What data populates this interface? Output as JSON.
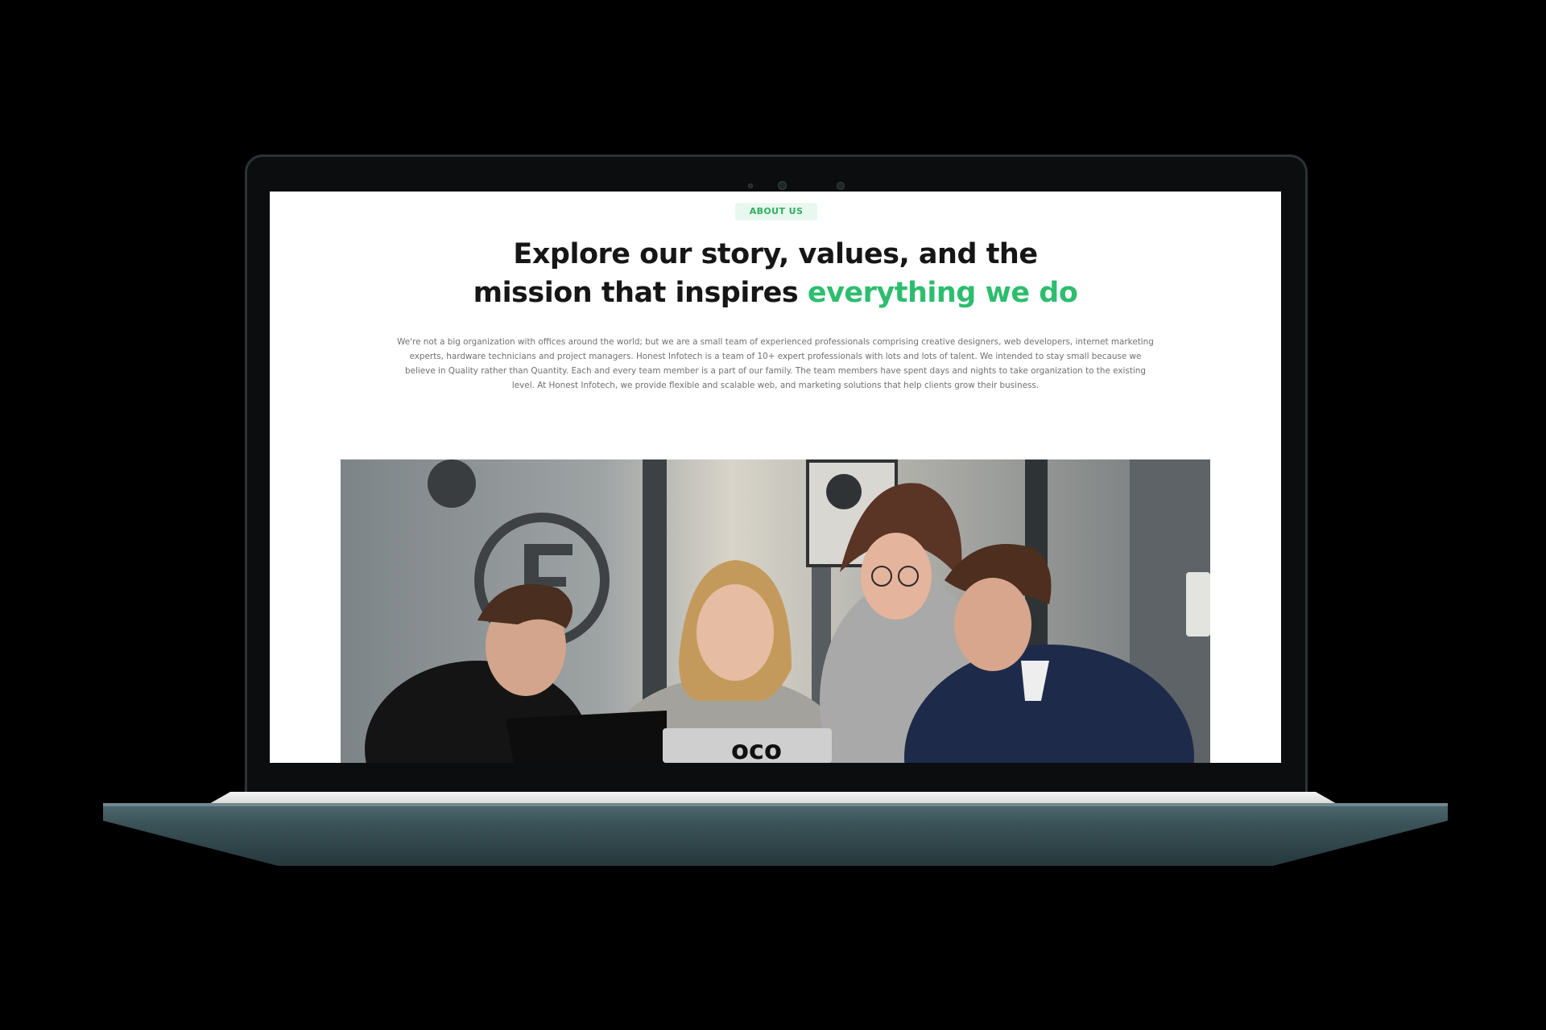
{
  "about": {
    "badge": "ABOUT US",
    "headline_line1": "Explore our story, values, and the",
    "headline_line2_main": "mission that inspires ",
    "headline_line2_accent": "everything we do",
    "intro_line1": "We're not a big organization with offices around the world; but we are a small team of experienced professionals comprising creative designers, web developers, internet marketing",
    "intro_line2": "experts, hardware technicians and project managers. Honest Infotech is a team of 10+ expert professionals with lots and lots of talent. We intended to stay small because we",
    "intro_line3": "believe in Quality rather than Quantity. Each and every team member is a part of our family. The team members have spent days and nights to take organization to the existing",
    "intro_line4": "level. At Honest Infotech, we provide flexible and scalable web, and marketing solutions that help clients grow their business."
  },
  "colors": {
    "accent": "#2dbd6e",
    "badge_bg": "#e9f8ee",
    "heading": "#161616",
    "body_text": "#707070",
    "laptop_body": "#3a5257"
  }
}
